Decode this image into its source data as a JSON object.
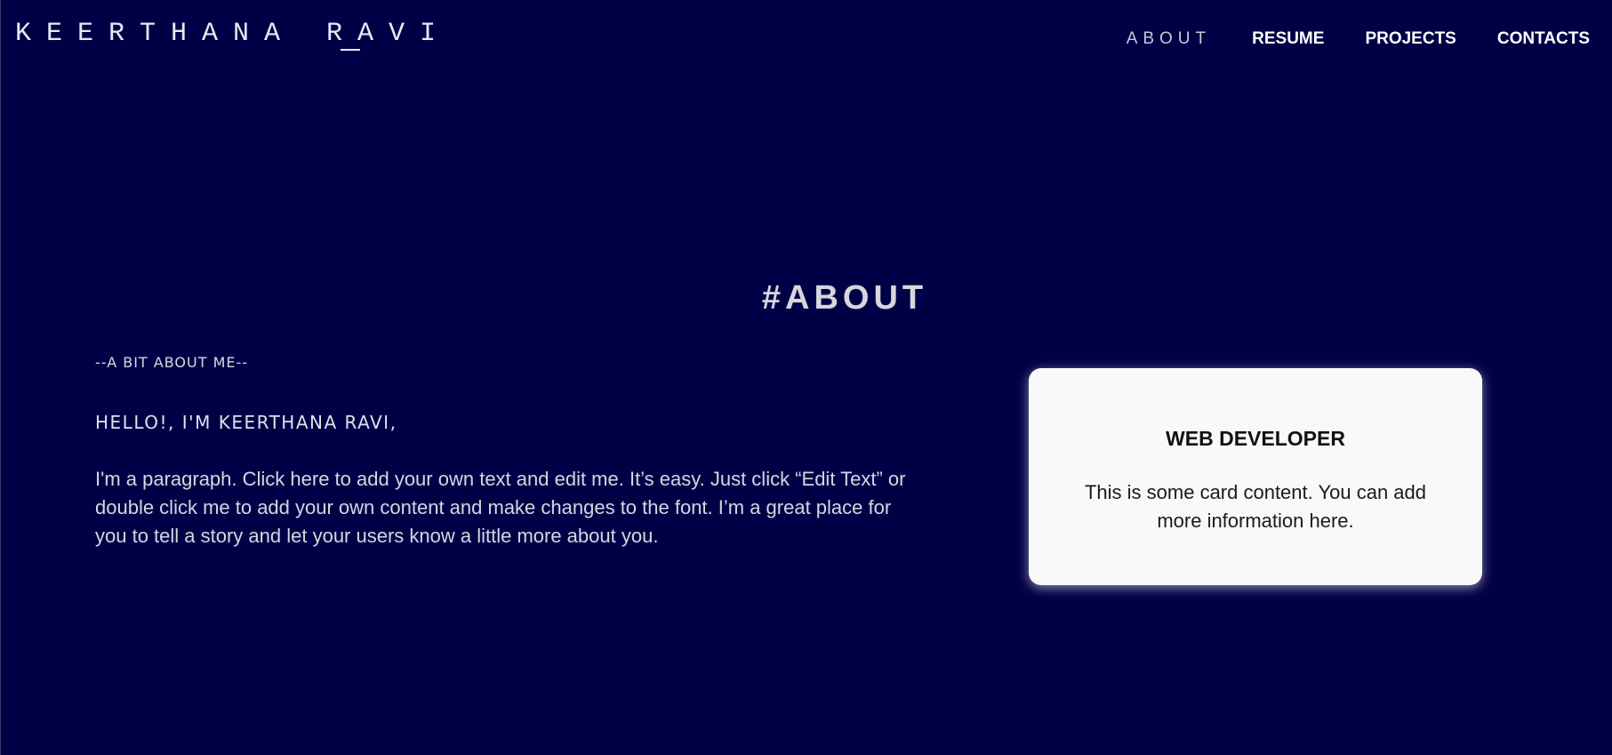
{
  "header": {
    "brand": "KEERTHANA RAVI",
    "nav": [
      {
        "label": "ABOUT",
        "active": true
      },
      {
        "label": "RESUME",
        "active": false
      },
      {
        "label": "PROJECTS",
        "active": false
      },
      {
        "label": "CONTACTS",
        "active": false
      }
    ]
  },
  "about": {
    "title": "#ABOUT",
    "subtitle": "--A BIT ABOUT ME--",
    "greeting": "HELLO!, I'M KEERTHANA RAVI,",
    "paragraph": "I'm a paragraph. Click here to add your own text and edit me. It’s easy. Just click “Edit Text” or double click me to add your own content and make changes to the font. I’m a great place for you to tell a story and let your users know a little more about you."
  },
  "card": {
    "title": "WEB DEVELOPER",
    "text": "This is some card content. You can add more information here."
  },
  "colors": {
    "background": "#000047",
    "card_background": "#f9f9fa",
    "text_light": "#d6d6e0"
  }
}
